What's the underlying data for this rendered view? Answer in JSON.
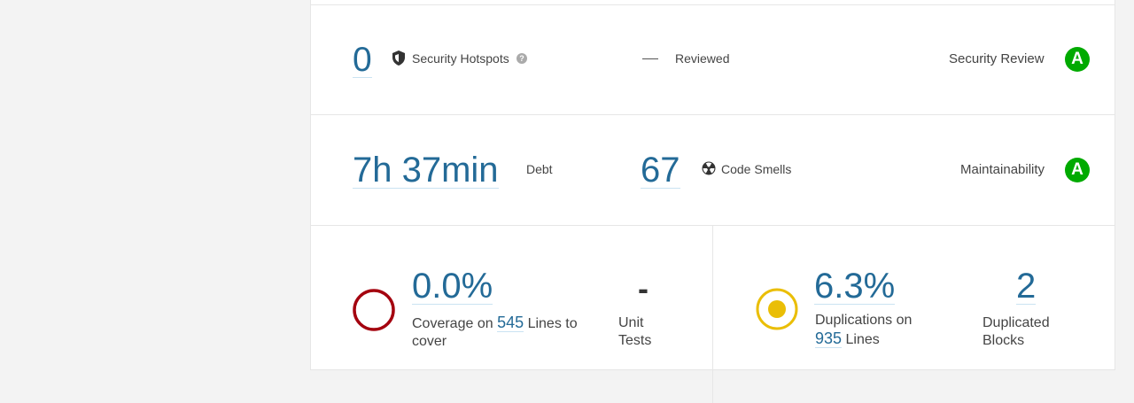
{
  "security": {
    "hotspots_count": "0",
    "hotspots_label": "Security Hotspots",
    "reviewed_value": "—",
    "reviewed_label": "Reviewed",
    "review_label": "Security Review",
    "review_grade": "A"
  },
  "maintainability": {
    "debt_value": "7h 37min",
    "debt_label": "Debt",
    "code_smells_count": "67",
    "code_smells_label": "Code Smells",
    "label": "Maintainability",
    "grade": "A"
  },
  "coverage": {
    "value": "0.0%",
    "text_before": "Coverage on",
    "lines_count": "545",
    "text_after_1": "Lines to",
    "text_after_2": "cover",
    "unit_tests_value": "-",
    "unit_tests_label_1": "Unit",
    "unit_tests_label_2": "Tests"
  },
  "duplications": {
    "value": "6.3%",
    "text_before": "Duplications on",
    "lines_count": "935",
    "text_after": "Lines",
    "blocks_count": "2",
    "blocks_label_1": "Duplicated",
    "blocks_label_2": "Blocks"
  },
  "colors": {
    "link": "#236a97",
    "grade_a": "#00aa00",
    "coverage_ring": "#a4030f",
    "duplication_ring": "#eabe06"
  },
  "icons": {
    "hotspot": "shield-icon",
    "help": "help-icon",
    "smell": "code-smell-icon"
  }
}
